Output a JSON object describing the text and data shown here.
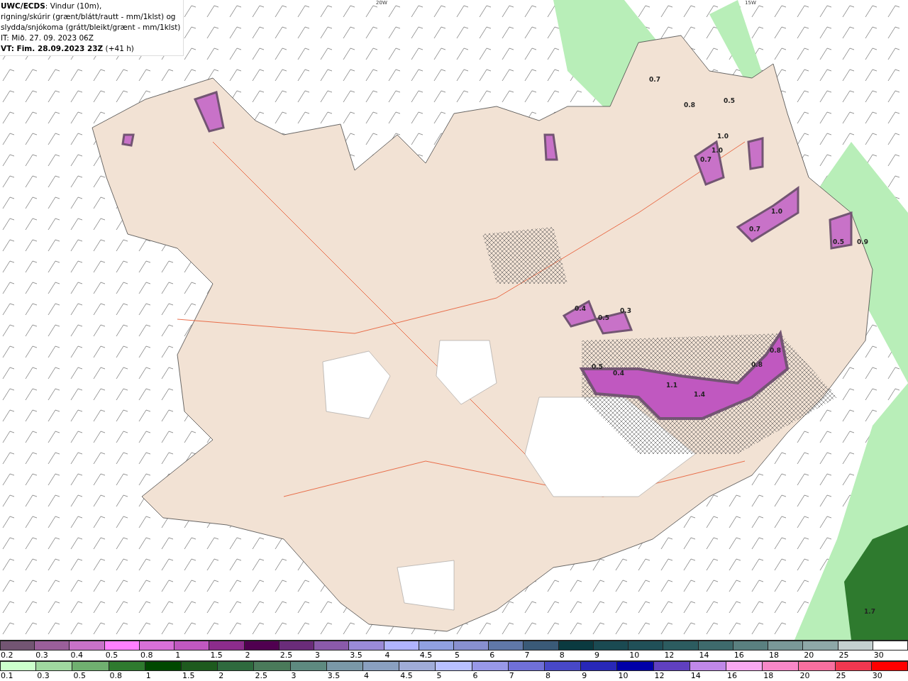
{
  "info": {
    "title": "UWC/ECDS",
    "title_rest": ": Vindur (10m),",
    "lines": [
      "rigning/skúrir (grænt/blátt/rautt - mm/1klst) og",
      "slydda/snjókoma (grátt/bleikt/grænt - mm/1klst)",
      "IT: Mið. 27. 09. 2023 06Z"
    ],
    "valid_bold": "VT: Fim. 28.09.2023 23Z",
    "valid_rest": "(+41 h)"
  },
  "map": {
    "grid_labels": [
      "20W",
      "15W"
    ],
    "value_labels": [
      "0.7",
      "0.8",
      "0.5",
      "1.0",
      "0.7",
      "1.0",
      "0.7",
      "1.0",
      "0.9",
      "0.5",
      "0.4",
      "0.3",
      "0.5",
      "0.5",
      "0.4",
      "1.1",
      "1.4",
      "0.8",
      "0.8",
      "1.7"
    ]
  },
  "legends": [
    {
      "items": [
        {
          "label": "0.2",
          "color": "#735573"
        },
        {
          "label": "0.3",
          "color": "#9a5f9a"
        },
        {
          "label": "0.4",
          "color": "#c872c8"
        },
        {
          "label": "0.5",
          "color": "#ff80ff"
        },
        {
          "label": "0.8",
          "color": "#d870d8"
        },
        {
          "label": "1",
          "color": "#c058c0"
        },
        {
          "label": "1.5",
          "color": "#8c2c8c"
        },
        {
          "label": "2",
          "color": "#500050"
        },
        {
          "label": "2.5",
          "color": "#6a2c7a"
        },
        {
          "label": "3",
          "color": "#8a5aaa"
        },
        {
          "label": "3.5",
          "color": "#9a8ad8"
        },
        {
          "label": "4",
          "color": "#b0b4ff"
        },
        {
          "label": "4.5",
          "color": "#90a0e0"
        },
        {
          "label": "5",
          "color": "#8890d0"
        },
        {
          "label": "6",
          "color": "#6078a8"
        },
        {
          "label": "7",
          "color": "#3a5a78"
        },
        {
          "label": "8",
          "color": "#0a3a40"
        },
        {
          "label": "9",
          "color": "#1a4a52"
        },
        {
          "label": "10",
          "color": "#205058"
        },
        {
          "label": "12",
          "color": "#2c5c60"
        },
        {
          "label": "14",
          "color": "#3e6a6c"
        },
        {
          "label": "16",
          "color": "#5a8080"
        },
        {
          "label": "18",
          "color": "#7a9898"
        },
        {
          "label": "20",
          "color": "#8ea8a8"
        },
        {
          "label": "25",
          "color": "#c4d0d0"
        },
        {
          "label": "30",
          "color": "#ffffff"
        }
      ]
    },
    {
      "items": [
        {
          "label": "0.1",
          "color": "#ccffcc"
        },
        {
          "label": "0.3",
          "color": "#a0d8a0"
        },
        {
          "label": "0.5",
          "color": "#70b070"
        },
        {
          "label": "0.8",
          "color": "#2e7a2e"
        },
        {
          "label": "1",
          "color": "#004800"
        },
        {
          "label": "1.5",
          "color": "#1e5a1e"
        },
        {
          "label": "2",
          "color": "#2e6a3e"
        },
        {
          "label": "2.5",
          "color": "#4a7a5a"
        },
        {
          "label": "3",
          "color": "#5e8a80"
        },
        {
          "label": "3.5",
          "color": "#7a98a8"
        },
        {
          "label": "4",
          "color": "#8aa0c0"
        },
        {
          "label": "4.5",
          "color": "#a0acd8"
        },
        {
          "label": "5",
          "color": "#b8c0ff"
        },
        {
          "label": "6",
          "color": "#9898e8"
        },
        {
          "label": "7",
          "color": "#7070d8"
        },
        {
          "label": "8",
          "color": "#4848c8"
        },
        {
          "label": "9",
          "color": "#2828b8"
        },
        {
          "label": "10",
          "color": "#0000a8"
        },
        {
          "label": "12",
          "color": "#6040c0"
        },
        {
          "label": "14",
          "color": "#c088e8"
        },
        {
          "label": "16",
          "color": "#f8a8f0"
        },
        {
          "label": "18",
          "color": "#f888c8"
        },
        {
          "label": "20",
          "color": "#f870a0"
        },
        {
          "label": "25",
          "color": "#f03850"
        },
        {
          "label": "30",
          "color": "#ff0000"
        }
      ]
    }
  ]
}
